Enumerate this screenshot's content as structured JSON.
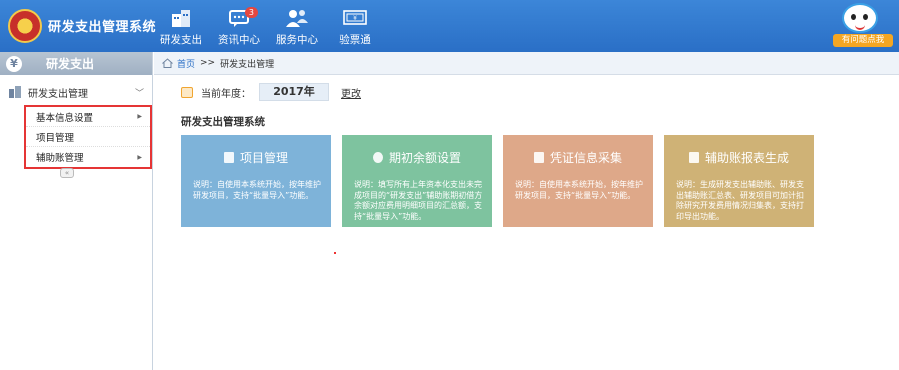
{
  "header": {
    "title": "研发支出管理系统",
    "nav": [
      {
        "label": "研发支出",
        "icon": "building-icon"
      },
      {
        "label": "资讯中心",
        "icon": "chat-icon",
        "badge": "3"
      },
      {
        "label": "服务中心",
        "icon": "people-icon"
      },
      {
        "label": "验票通",
        "icon": "invoice-icon"
      }
    ],
    "help_label": "有问题点我"
  },
  "sidebar": {
    "title": "研发支出",
    "section": "研发支出管理",
    "submenu": [
      "基本信息设置",
      "项目管理",
      "辅助账管理"
    ]
  },
  "breadcrumb": {
    "home": "首页",
    "sep": ">>",
    "current": "研发支出管理"
  },
  "year": {
    "label": "当前年度：",
    "value": "2017年",
    "change": "更改"
  },
  "system_title": "研发支出管理系统",
  "cards": [
    {
      "title": "项目管理",
      "desc": "说明：自使用本系统开始，按年维护研发项目，支持“批量导入”功能。",
      "color": "#7eb3d9"
    },
    {
      "title": "期初余额设置",
      "desc": "说明：填写所有上年资本化支出未完成项目的“研发支出”辅助账期初借方余额对应费用明细项目的汇总额，支持“批量导入”功能。",
      "color": "#7ec39f"
    },
    {
      "title": "凭证信息采集",
      "desc": "说明：自使用本系统开始，按年维护研发项目，支持“批量导入”功能。",
      "color": "#dea889"
    },
    {
      "title": "辅助账报表生成",
      "desc": "说明：生成研发支出辅助账、研发支出辅助账汇总表、研发项目可加计扣除研究开发费用情况归集表，支持打印导出功能。",
      "color": "#cfb276"
    }
  ]
}
